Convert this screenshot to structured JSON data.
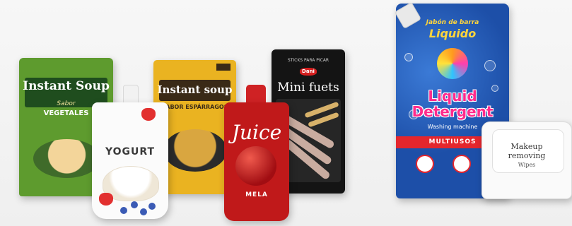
{
  "soup_green": {
    "title": "Instant Soup",
    "sub1": "Sabor",
    "sub2": "VEGETALES"
  },
  "yogurt": {
    "name": "YOGURT"
  },
  "soup_yellow": {
    "title": "Instant soup",
    "sub": "SABOR ESPÁRRAGOS"
  },
  "juice": {
    "name": "Juice",
    "sub": "MELA"
  },
  "fuets": {
    "top": "STICKS PARA PICAR",
    "brand": "Dani",
    "name": "Mini fuets"
  },
  "detergent": {
    "line1": "Jabón de barra",
    "line2": "Liquido",
    "name1": "Liquid",
    "name2": "Detergent",
    "sub": "Washing machine",
    "band": "MULTIUSOS"
  },
  "wipes": {
    "line1": "Makeup",
    "line2": "removing",
    "line3": "Wipes"
  }
}
